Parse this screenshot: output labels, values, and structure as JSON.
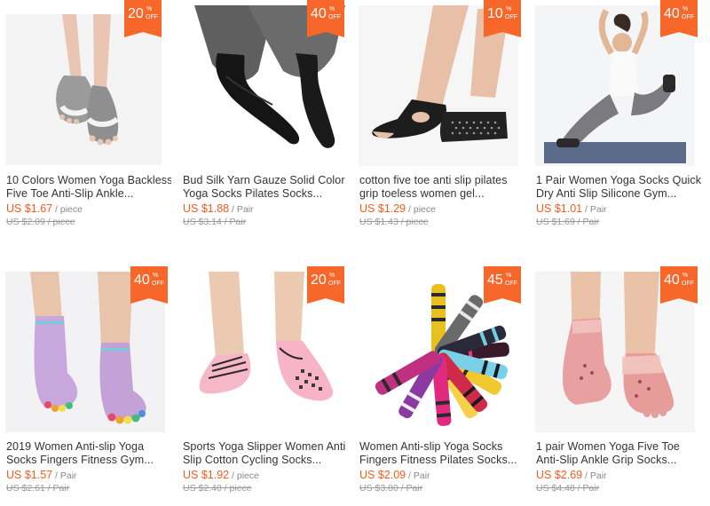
{
  "colors": {
    "badge": "#f7672a",
    "price": "#f55b1f",
    "text": "#333333",
    "muted": "#999999"
  },
  "products": [
    {
      "discount": "20",
      "pct_sign": "%",
      "off_label": "OFF",
      "title_line1": "10 Colors Women Yoga Backless",
      "title_line2": "Five Toe Anti-Slip Ankle...",
      "price": "US $1.67",
      "unit": " / piece",
      "original_price": "US $2.09",
      "original_unit": " / piece",
      "image": "grey-backless-toe-socks"
    },
    {
      "discount": "40",
      "pct_sign": "%",
      "off_label": "OFF",
      "title_line1": "Bud Silk Yarn Gauze Solid Color",
      "title_line2": "Yoga Socks Pilates Socks...",
      "price": "US $1.88",
      "unit": " / Pair",
      "original_price": "US $3.14",
      "original_unit": " / Pair",
      "image": "black-mesh-toe-socks"
    },
    {
      "discount": "10",
      "pct_sign": "%",
      "off_label": "OFF",
      "title_line1": "cotton five toe anti slip pilates",
      "title_line2": "grip toeless women gel...",
      "price": "US $1.29",
      "unit": " / piece",
      "original_price": "US $1.43",
      "original_unit": " / piece",
      "image": "black-toeless-grip-socks"
    },
    {
      "discount": "40",
      "pct_sign": "%",
      "off_label": "OFF",
      "title_line1": "1 Pair Women Yoga Socks Quick-",
      "title_line2": "Dry Anti Slip Silicone Gym...",
      "price": "US $1.01",
      "unit": " / Pair",
      "original_price": "US $1.69",
      "original_unit": " / Pair",
      "image": "woman-yoga-pose"
    },
    {
      "discount": "40",
      "pct_sign": "%",
      "off_label": "OFF",
      "title_line1": "2019 Women Anti-slip Yoga",
      "title_line2": "Socks Fingers Fitness Gym...",
      "price": "US $1.57",
      "unit": " / Pair",
      "original_price": "US $2.61",
      "original_unit": " / Pair",
      "image": "lilac-rainbow-toe-socks"
    },
    {
      "discount": "20",
      "pct_sign": "%",
      "off_label": "OFF",
      "title_line1": "Sports Yoga Slipper Women Anti",
      "title_line2": "Slip Cotton Cycling Socks...",
      "price": "US $1.92",
      "unit": " / piece",
      "original_price": "US $2.40",
      "original_unit": " / piece",
      "image": "pink-slipper-socks"
    },
    {
      "discount": "45",
      "pct_sign": "%",
      "off_label": "OFF",
      "title_line1": "Women Anti-slip Yoga Socks",
      "title_line2": "Fingers Fitness Pilates Socks...",
      "price": "US $2.09",
      "unit": " / Pair",
      "original_price": "US $3.80",
      "original_unit": " / Pair",
      "image": "striped-toe-socks-fan"
    },
    {
      "discount": "40",
      "pct_sign": "%",
      "off_label": "OFF",
      "title_line1": "1 pair Women Yoga Five Toe",
      "title_line2": "Anti-Slip Ankle Grip Socks...",
      "price": "US $2.69",
      "unit": " / Pair",
      "original_price": "US $4.48",
      "original_unit": " / Pair",
      "image": "pink-lace-toe-socks"
    }
  ]
}
